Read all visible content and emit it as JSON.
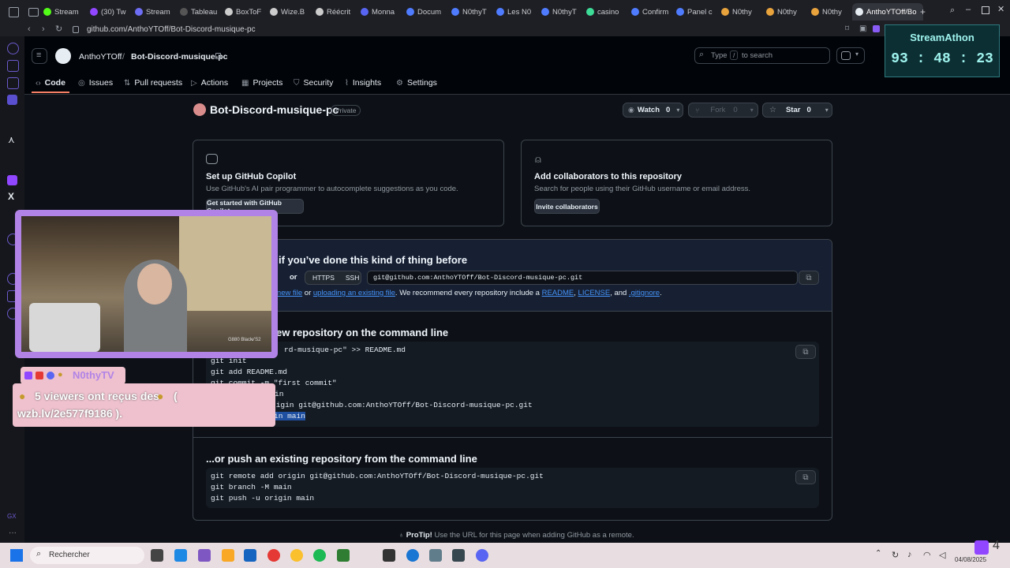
{
  "browser": {
    "tabs": [
      {
        "label": "Stream",
        "color": "#53fc18"
      },
      {
        "label": "(30) Tw",
        "color": "#9146ff"
      },
      {
        "label": "Stream",
        "color": "#6e6ef5"
      },
      {
        "label": "Tableau",
        "color": "#555555"
      },
      {
        "label": "BoxToF",
        "color": "#cccccc"
      },
      {
        "label": "Wize.B",
        "color": "#cccccc"
      },
      {
        "label": "Réécrit",
        "color": "#cccccc"
      },
      {
        "label": "Monna",
        "color": "#5865f2"
      },
      {
        "label": "Docum",
        "color": "#4f7cff"
      },
      {
        "label": "N0thyT",
        "color": "#4f7cff"
      },
      {
        "label": "Les N0",
        "color": "#4f7cff"
      },
      {
        "label": "N0thyT",
        "color": "#4f7cff"
      },
      {
        "label": "casino",
        "color": "#3ddc97"
      },
      {
        "label": "Confirm",
        "color": "#4f7cff"
      },
      {
        "label": "Panel c",
        "color": "#4f7cff"
      },
      {
        "label": "N0thy",
        "color": "#e8a33d"
      },
      {
        "label": "N0thy",
        "color": "#e8a33d"
      },
      {
        "label": "N0thy",
        "color": "#e8a33d"
      }
    ],
    "active_tab": "AnthoYTOff/Bo",
    "url": "github.com/AnthoYTOff/Bot-Discord-musique-pc"
  },
  "header": {
    "owner": "AnthoYTOff",
    "separator": "/",
    "repo": "Bot-Discord-musique-pc",
    "search_placeholder": "Type",
    "search_key": "/",
    "search_suffix": "to search"
  },
  "nav": {
    "tabs": [
      "Code",
      "Issues",
      "Pull requests",
      "Actions",
      "Projects",
      "Security",
      "Insights",
      "Settings"
    ]
  },
  "repo": {
    "name": "Bot-Discord-musique-pc",
    "visibility": "Private",
    "watch_label": "Watch",
    "watch_count": "0",
    "fork_label": "Fork",
    "fork_count": "0",
    "star_label": "Star",
    "star_count": "0"
  },
  "copilot_card": {
    "title": "Set up GitHub Copilot",
    "desc": "Use GitHub's AI pair programmer to autocomplete suggestions as you code.",
    "button": "Get started with GitHub Copilot"
  },
  "collab_card": {
    "title": "Add collaborators to this repository",
    "desc": "Search for people using their GitHub username or email address.",
    "button": "Invite collaborators"
  },
  "quick_setup": {
    "title_visible": "if you’ve done this kind of thing before",
    "or": "or",
    "https": "HTTPS",
    "ssh": "SSH",
    "clone_url": "git@github.com:AnthoYTOff/Bot-Discord-musique-pc.git",
    "hint_link1": "a new file",
    "hint_or": "or",
    "hint_link2": "uploading an existing file",
    "hint_mid": ". We recommend every repository include a",
    "readme": "README",
    "comma": ",",
    "license": "LICENSE",
    "and": ", and",
    "gitignore": ".gitignore",
    "period": "."
  },
  "new_repo": {
    "title_visible": "ew repository on the command line",
    "lines": [
      "rd-musique-pc\" >> README.md",
      "git init",
      "git add README.md",
      "git commit -m \"first commit\"",
      "in",
      "rigin git@github.com:AnthoYTOff/Bot-Discord-musique-pc.git",
      "in main"
    ]
  },
  "push_existing": {
    "title": "...or push an existing repository from the command line",
    "lines": [
      "git remote add origin git@github.com:AnthoYTOff/Bot-Discord-musique-pc.git",
      "git branch -M main",
      "git push -u origin main"
    ]
  },
  "protip": {
    "label": "ProTip!",
    "text": "Use the URL for this page when adding GitHub as a remote."
  },
  "overlay": {
    "timer_title": "StreamAthon",
    "timer_value": "93 : 48 : 23",
    "alert_name": "N0thyTV",
    "alert_line1": "5 viewers ont reçus des",
    "alert_line1_end": "(",
    "alert_line2": "wzb.lv/2e577f9186 ).",
    "cam_label": "G880 Black",
    "cam_tag": "v'S2"
  },
  "taskbar": {
    "search_placeholder": "Rechercher",
    "date": "04/08/2025",
    "twitch_count": "4"
  },
  "colors": {
    "accent_underline": "#f78166",
    "link": "#4493f8",
    "overlay_purple": "#b183e6",
    "alert_pink": "#efc1ce",
    "timer_text": "#9ff3ee"
  }
}
